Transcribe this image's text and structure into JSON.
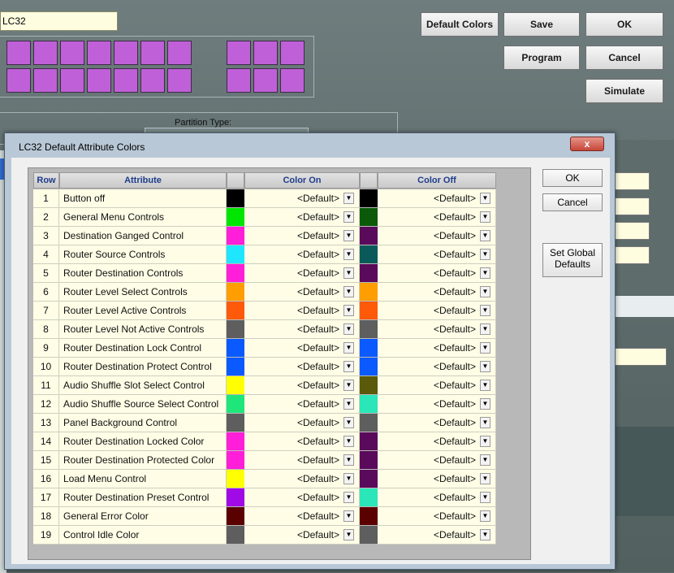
{
  "app": {
    "panel_name": "LC32",
    "buttons": {
      "default_colors": "Default Colors",
      "save": "Save",
      "ok": "OK",
      "program": "Program",
      "cancel": "Cancel",
      "simulate": "Simulate"
    },
    "partition_label": "Partition Type:"
  },
  "dialog": {
    "title": "LC32 Default Attribute Colors",
    "close_glyph": "x",
    "columns": {
      "row": "Row",
      "attribute": "Attribute",
      "color_on": "Color On",
      "color_off": "Color Off"
    },
    "rows": [
      {
        "row": "1",
        "attribute": "Button off",
        "on_color": "#000000",
        "on_value": "<Default>",
        "off_color": "#000000",
        "off_value": "<Default>"
      },
      {
        "row": "2",
        "attribute": "General Menu Controls",
        "on_color": "#00e600",
        "on_value": "<Default>",
        "off_color": "#0a5a0a",
        "off_value": "<Default>"
      },
      {
        "row": "3",
        "attribute": "Destination Ganged Control",
        "on_color": "#ff1fd8",
        "on_value": "<Default>",
        "off_color": "#5a0a5a",
        "off_value": "<Default>"
      },
      {
        "row": "4",
        "attribute": "Router Source Controls",
        "on_color": "#1fe6ff",
        "on_value": "<Default>",
        "off_color": "#0a5a5a",
        "off_value": "<Default>"
      },
      {
        "row": "5",
        "attribute": "Router Destination Controls",
        "on_color": "#ff1fd8",
        "on_value": "<Default>",
        "off_color": "#5a0a5a",
        "off_value": "<Default>"
      },
      {
        "row": "6",
        "attribute": "Router Level Select Controls",
        "on_color": "#ff9e00",
        "on_value": "<Default>",
        "off_color": "#ff9e00",
        "off_value": "<Default>"
      },
      {
        "row": "7",
        "attribute": "Router Level Active Controls",
        "on_color": "#ff5a0a",
        "on_value": "<Default>",
        "off_color": "#ff5a0a",
        "off_value": "<Default>"
      },
      {
        "row": "8",
        "attribute": "Router Level Not Active Controls",
        "on_color": "#5e5e5e",
        "on_value": "<Default>",
        "off_color": "#5e5e5e",
        "off_value": "<Default>"
      },
      {
        "row": "9",
        "attribute": "Router Destination Lock Control",
        "on_color": "#0a5aff",
        "on_value": "<Default>",
        "off_color": "#0a5aff",
        "off_value": "<Default>"
      },
      {
        "row": "10",
        "attribute": "Router Destination Protect Control",
        "on_color": "#0a5aff",
        "on_value": "<Default>",
        "off_color": "#0a5aff",
        "off_value": "<Default>"
      },
      {
        "row": "11",
        "attribute": "Audio Shuffle Slot Select Control",
        "on_color": "#ffff00",
        "on_value": "<Default>",
        "off_color": "#5a5a0a",
        "off_value": "<Default>"
      },
      {
        "row": "12",
        "attribute": "Audio Shuffle Source Select Control",
        "on_color": "#1ee67a",
        "on_value": "<Default>",
        "off_color": "#2ae6b8",
        "off_value": "<Default>"
      },
      {
        "row": "13",
        "attribute": "Panel Background Control",
        "on_color": "#5e5e5e",
        "on_value": "<Default>",
        "off_color": "#5e5e5e",
        "off_value": "<Default>"
      },
      {
        "row": "14",
        "attribute": "Router Destination Locked Color",
        "on_color": "#ff1fd8",
        "on_value": "<Default>",
        "off_color": "#5a0a5a",
        "off_value": "<Default>"
      },
      {
        "row": "15",
        "attribute": "Router Destination Protected Color",
        "on_color": "#ff1fd8",
        "on_value": "<Default>",
        "off_color": "#5a0a5a",
        "off_value": "<Default>"
      },
      {
        "row": "16",
        "attribute": "Load Menu Control",
        "on_color": "#ffff00",
        "on_value": "<Default>",
        "off_color": "#5a0a5a",
        "off_value": "<Default>"
      },
      {
        "row": "17",
        "attribute": "Router Destination Preset Control",
        "on_color": "#a00ae6",
        "on_value": "<Default>",
        "off_color": "#2ae6b8",
        "off_value": "<Default>"
      },
      {
        "row": "18",
        "attribute": "General Error Color",
        "on_color": "#5a0000",
        "on_value": "<Default>",
        "off_color": "#5a0000",
        "off_value": "<Default>"
      },
      {
        "row": "19",
        "attribute": "Control Idle Color",
        "on_color": "#5e5e5e",
        "on_value": "<Default>",
        "off_color": "#5e5e5e",
        "off_value": "<Default>"
      }
    ],
    "buttons": {
      "ok": "OK",
      "cancel": "Cancel",
      "set_global_line1": "Set Global",
      "set_global_line2": "Defaults"
    }
  },
  "icons": {
    "dropdown": "dropdown-arrow-icon",
    "close": "close-icon"
  },
  "colors": {
    "pad": "#c060d8",
    "cell_bg": "#fffde6",
    "header_text": "#1e3c8c",
    "close_red": "#c7463a"
  }
}
